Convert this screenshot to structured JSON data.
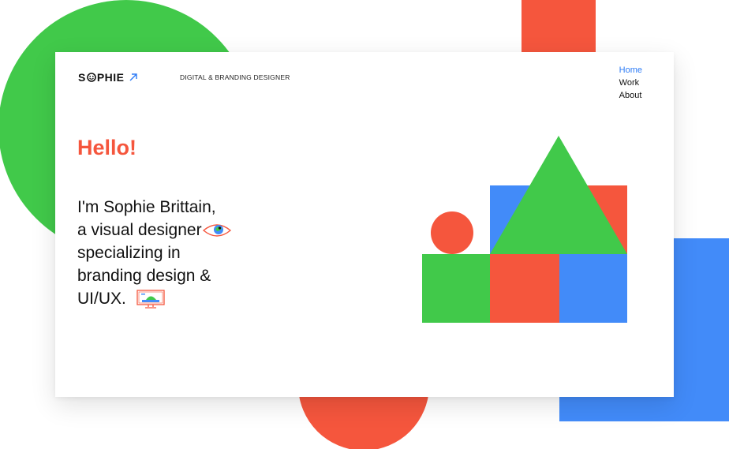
{
  "brand": {
    "logo_before": "S",
    "logo_after": "PHIE",
    "tagline": "DIGITAL & BRANDING DESIGNER"
  },
  "nav": {
    "items": [
      {
        "label": "Home",
        "active": true
      },
      {
        "label": "Work",
        "active": false
      },
      {
        "label": "About",
        "active": false
      }
    ]
  },
  "hero": {
    "greeting": "Hello!",
    "line1": "I'm Sophie Brittain,",
    "line2": "a visual designer",
    "line3": "specializing in",
    "line4": "branding design &",
    "line5": "UI/UX."
  },
  "colors": {
    "red": "#f5563d",
    "green": "#41c94a",
    "blue": "#428bf9",
    "link_active": "#2e7cf6"
  },
  "icons": [
    "arrow-up-right-icon",
    "smile-icon",
    "eye-icon",
    "monitor-icon"
  ]
}
